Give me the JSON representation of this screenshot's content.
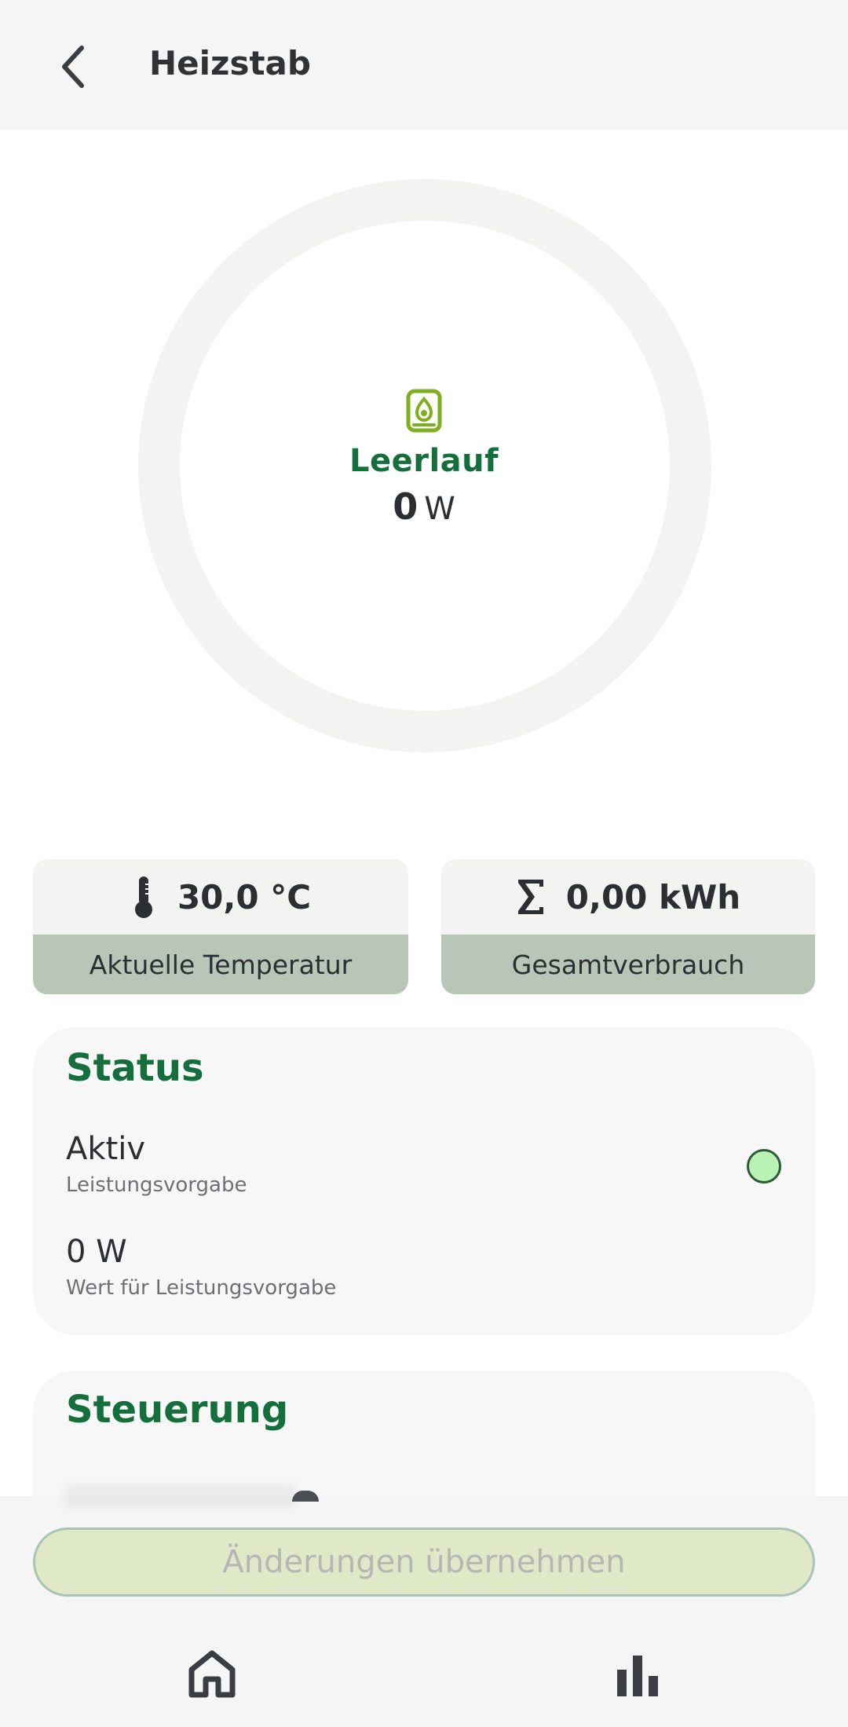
{
  "header": {
    "title": "Heizstab",
    "back_icon": "arrow-back-icon"
  },
  "ring": {
    "icon": "water-heater-icon",
    "status": "Leerlauf",
    "power_value": "0",
    "power_unit": "W"
  },
  "stats": {
    "temperature": {
      "icon": "thermometer-icon",
      "value": "30,0 °C",
      "label": "Aktuelle Temperatur"
    },
    "total": {
      "icon": "sigma-icon",
      "value": "0,00 kWh",
      "label": "Gesamtverbrauch"
    }
  },
  "status": {
    "title": "Status",
    "rows": [
      {
        "value": "Aktiv",
        "label": "Leistungsvorgabe"
      },
      {
        "value": "0 W",
        "label": "Wert für Leistungsvorgabe"
      }
    ]
  },
  "control": {
    "title": "Steuerung"
  },
  "actions": {
    "apply_label": "Änderungen übernehmen"
  },
  "bottom_nav": {
    "items": [
      "home-icon",
      "bar-chart-icon"
    ]
  },
  "colors": {
    "accent_green": "#156f3d",
    "icon_green": "#7fae1f",
    "status_dot": "#b9f2b4",
    "stat_label_bg": "#b7c6b7",
    "apply_bg": "#dfe9c7"
  }
}
